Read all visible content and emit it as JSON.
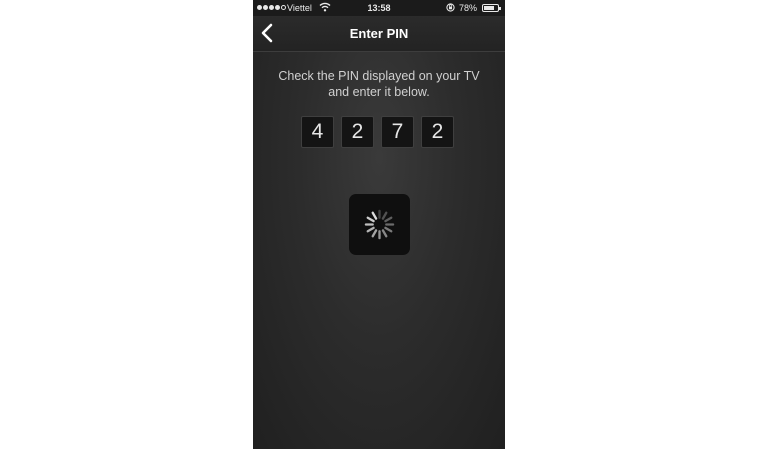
{
  "status_bar": {
    "carrier": "Viettel",
    "time": "13:58",
    "battery_percent": "78%",
    "battery_level": 0.78,
    "signal_bars_filled": 4,
    "signal_bars_total": 5,
    "wifi_icon": "wifi-icon",
    "rotation_lock_icon": "rotation-lock-icon"
  },
  "nav": {
    "title": "Enter PIN",
    "back_icon": "chevron-left-icon"
  },
  "main": {
    "instructions_line1": "Check the PIN displayed on your TV",
    "instructions_line2": "and enter it below.",
    "pin_digits": [
      "4",
      "2",
      "7",
      "2"
    ],
    "spinner_icon": "loading-spinner-icon"
  },
  "colors": {
    "background": "#2c2c2c",
    "text": "#d0d0d0",
    "pin_box": "#141414"
  }
}
